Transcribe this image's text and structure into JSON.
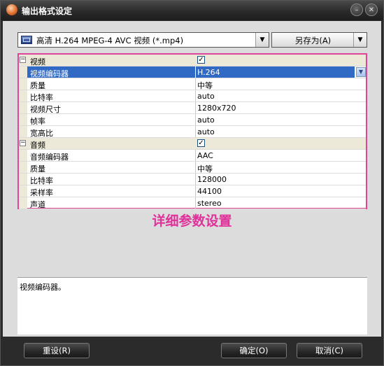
{
  "window": {
    "title": "输出格式设定"
  },
  "format": {
    "selected": "高清 H.264 MPEG-4 AVC 视频 (*.mp4)",
    "save_as_label": "另存为(A)"
  },
  "video": {
    "category": "视频",
    "checked": true,
    "props": [
      {
        "name": "视频编码器",
        "value": "H.264"
      },
      {
        "name": "质量",
        "value": "中等"
      },
      {
        "name": "比特率",
        "value": "auto"
      },
      {
        "name": "视频尺寸",
        "value": "1280x720"
      },
      {
        "name": "帧率",
        "value": "auto"
      },
      {
        "name": "宽高比",
        "value": "auto"
      }
    ]
  },
  "audio": {
    "category": "音频",
    "checked": true,
    "props": [
      {
        "name": "音频编码器",
        "value": "AAC"
      },
      {
        "name": "质量",
        "value": "中等"
      },
      {
        "name": "比特率",
        "value": "128000"
      },
      {
        "name": "采样率",
        "value": "44100"
      },
      {
        "name": "声道",
        "value": "stereo"
      }
    ]
  },
  "annotation": "详细参数设置",
  "description": "视频编码器。",
  "buttons": {
    "reset": "重设(R)",
    "ok": "确定(O)",
    "cancel": "取消(C)"
  },
  "colors": {
    "annotation": "#e0309a",
    "selection": "#316ac5",
    "highlight_border": "#e0459a"
  }
}
